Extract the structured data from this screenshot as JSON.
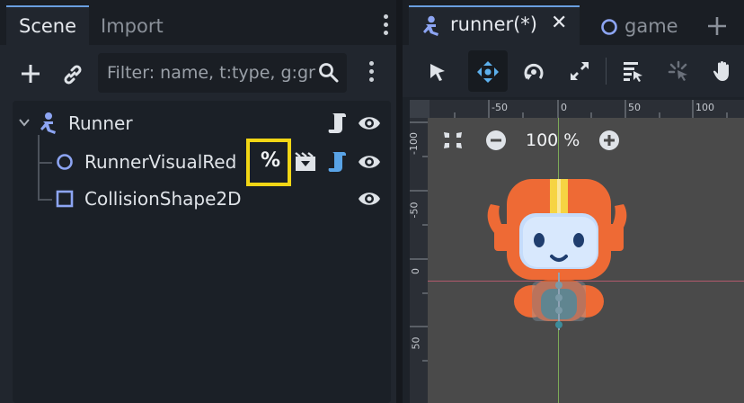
{
  "left_panel": {
    "tabs": [
      {
        "label": "Scene",
        "active": true
      },
      {
        "label": "Import",
        "active": false
      }
    ],
    "filter": {
      "placeholder": "Filter: name, t:type, g:group"
    },
    "tree": [
      {
        "name": "Runner",
        "icon": "runner-node-icon"
      },
      {
        "name": "RunnerVisualRed",
        "icon": "node2d-circle-icon",
        "unique_name_symbol": "%"
      },
      {
        "name": "CollisionShape2D",
        "icon": "collision-shape-icon"
      }
    ]
  },
  "editor": {
    "tabs": [
      {
        "label": "runner(*)",
        "active": true,
        "close": "✕"
      },
      {
        "label": "game",
        "active": false
      }
    ],
    "zoom": {
      "level": "100 %"
    },
    "ruler_top": [
      "-50",
      "0",
      "50",
      "100"
    ],
    "ruler_left": [
      "-100",
      "-50",
      "0",
      "50"
    ]
  },
  "colors": {
    "accent": "#6a9fe0",
    "highlight": "#f2d615",
    "robot_orange": "#ee6a35",
    "robot_yellow": "#f6d443"
  }
}
